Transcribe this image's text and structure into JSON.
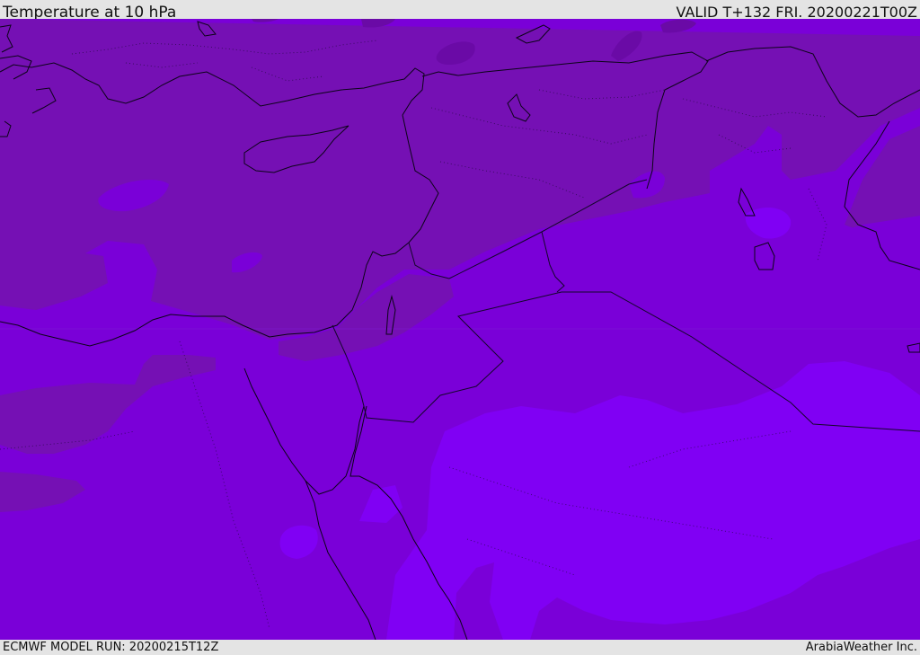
{
  "header": {
    "title": "Temperature at 10 hPa",
    "valid": "VALID T+132 FRI. 20200221T00Z"
  },
  "footer": {
    "model_run": "ECMWF MODEL RUN: 20200215T12Z",
    "credit": "ArabiaWeather Inc."
  },
  "colors": {
    "background": "#e4e4e4",
    "shade_dark": "#6a0aa6",
    "shade_mid_dark": "#7510b4",
    "shade_mid": "#7a00d8",
    "shade_light": "#8000f4",
    "coastline": "#0c0418"
  }
}
